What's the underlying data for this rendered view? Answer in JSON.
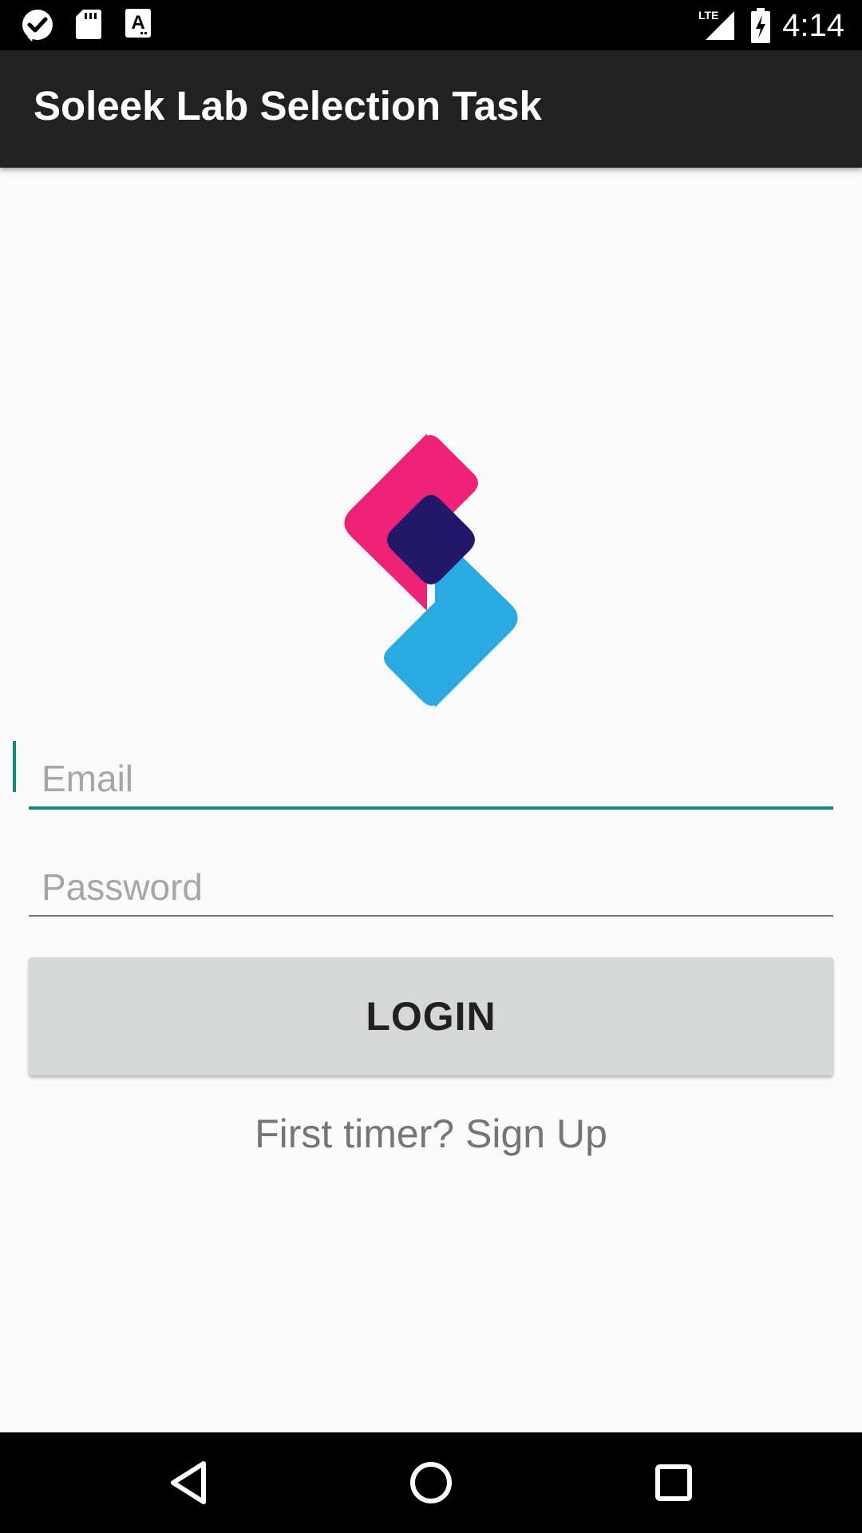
{
  "status_bar": {
    "time": "4:14",
    "network": "LTE",
    "icons": [
      "check-circle-icon",
      "sd-card-icon",
      "keyboard-a-icon",
      "lte-signal-icon",
      "battery-charging-icon"
    ]
  },
  "app_bar": {
    "title": "Soleek Lab Selection Task",
    "background": "#212121"
  },
  "logo": {
    "icon": "soleek-logo-icon",
    "colors": {
      "pink": "#ee2277",
      "blue": "#29abe2",
      "overlap": "#22176b"
    }
  },
  "form": {
    "email": {
      "value": "",
      "placeholder": "Email",
      "focused": true
    },
    "password": {
      "value": "",
      "placeholder": "Password"
    },
    "login_label": "LOGIN",
    "signup_text": "First timer? Sign Up",
    "accent_color": "#14897b"
  },
  "nav_bar": {
    "icons": [
      "back-triangle-icon",
      "home-circle-icon",
      "recents-square-icon"
    ]
  }
}
